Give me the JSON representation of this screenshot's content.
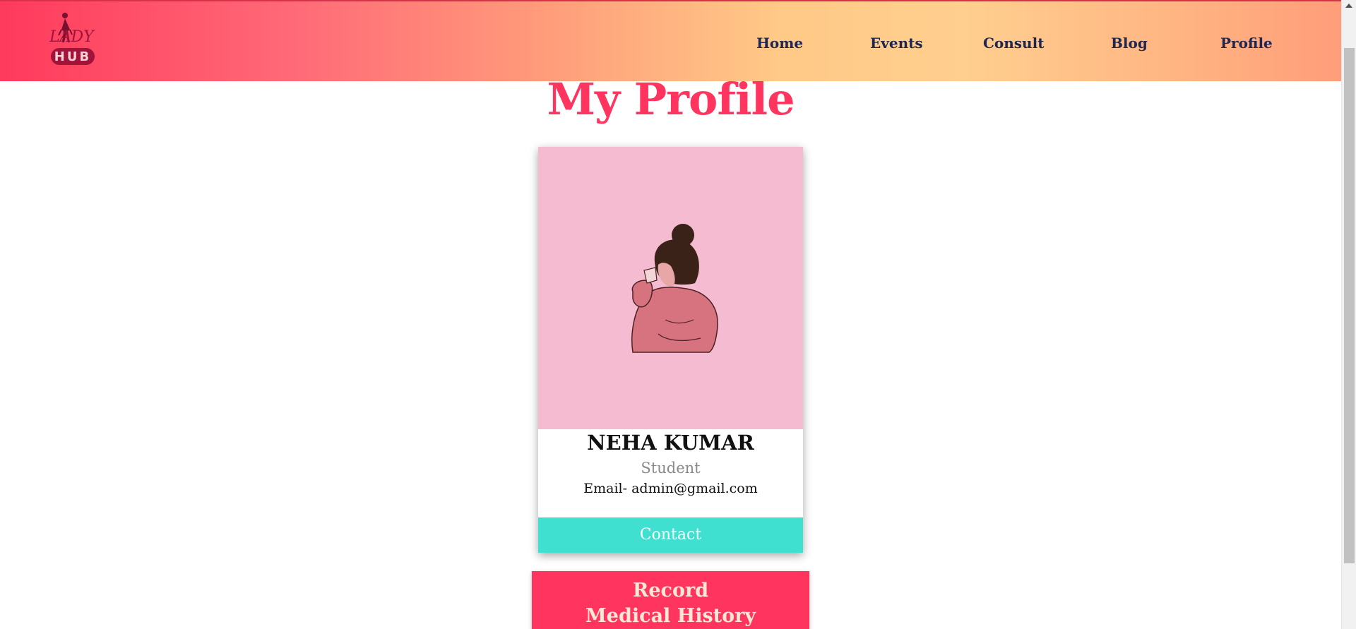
{
  "header": {
    "logo_text_top": "LADY",
    "logo_text_bottom": "HUB",
    "nav": [
      {
        "label": "Home"
      },
      {
        "label": "Events"
      },
      {
        "label": "Consult"
      },
      {
        "label": "Blog"
      },
      {
        "label": "Profile"
      }
    ]
  },
  "main": {
    "title": "My Profile",
    "card": {
      "name": "NEHA KUMAR",
      "role": "Student",
      "email": "Email- admin@gmail.com",
      "contact_label": "Contact"
    },
    "record_button": {
      "line1": "Record",
      "line2": "Medical History"
    }
  },
  "colors": {
    "accent": "#ff3560",
    "nav_text": "#1f2750",
    "contact": "#40e0d0",
    "card_photo_bg": "#f5bbd0"
  },
  "icons": {
    "logo": "lady-hub-logo",
    "profile_image": "woman-drinking-illustration"
  }
}
